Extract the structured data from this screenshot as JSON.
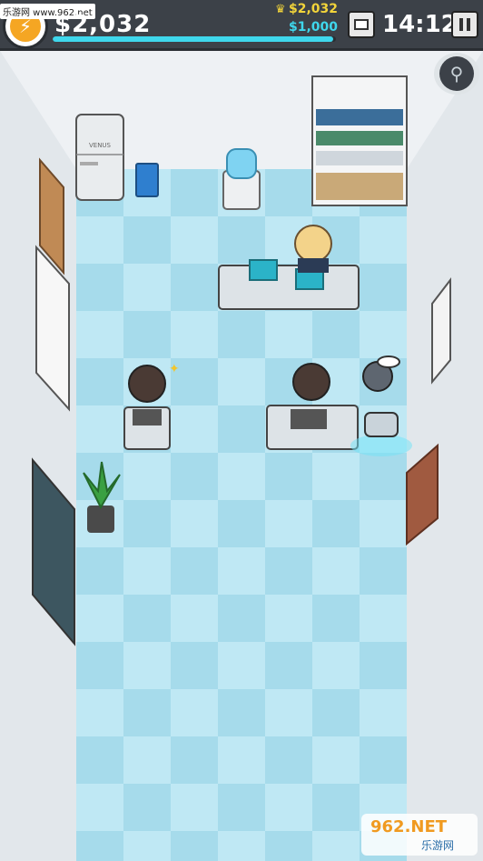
{
  "hud": {
    "money": "$2,032",
    "crown_money": "$2,032",
    "goal_money": "$1,000",
    "clock": "14:12",
    "progress": 0.99
  },
  "watermark": {
    "top_text": "乐游网 www.962.net",
    "bottom_logo": "962.NET",
    "bottom_sub": "乐游网"
  },
  "items": {
    "fridge_label": "VENUS"
  },
  "colors": {
    "hud_bg": "#3c4148",
    "money": "#ffffff",
    "crown": "#f2d43a",
    "progress": "#3fd7ec",
    "floor_a": "#bfe8f4",
    "floor_b": "#a8dcec",
    "wall": "#e6ebef"
  }
}
